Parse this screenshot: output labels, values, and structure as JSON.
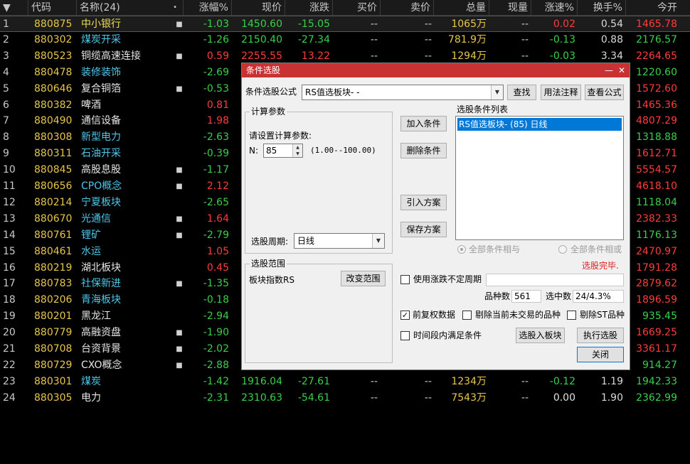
{
  "table": {
    "headers": [
      "代码",
      "名称(24)",
      "涨幅%",
      "现价",
      "涨跌",
      "买价",
      "卖价",
      "总量",
      "现量",
      "涨速%",
      "换手%",
      "今开"
    ],
    "sort_indicator": "•",
    "rows": [
      {
        "idx": "1",
        "code": "880875",
        "name": "中小银行",
        "name_color": "yellow",
        "mark": "■",
        "pct": "-1.03",
        "price": "1450.60",
        "chg": "-15.05",
        "bid": "--",
        "ask": "--",
        "vol": "1065万",
        "cur": "--",
        "spd": "0.02",
        "turn": "0.54",
        "open": "1465.78",
        "dir": "down",
        "spd_dir": "up",
        "open_dir": "up"
      },
      {
        "idx": "2",
        "code": "880302",
        "name": "煤炭开采",
        "name_color": "cyan",
        "mark": "",
        "pct": "-1.26",
        "price": "2150.40",
        "chg": "-27.34",
        "bid": "--",
        "ask": "--",
        "vol": "781.9万",
        "cur": "--",
        "spd": "-0.13",
        "turn": "0.88",
        "open": "2176.57",
        "dir": "down",
        "spd_dir": "down",
        "open_dir": "down"
      },
      {
        "idx": "3",
        "code": "880523",
        "name": "铜缆高速连接",
        "name_color": "white",
        "mark": "■",
        "pct": "0.59",
        "price": "2255.55",
        "chg": "13.22",
        "bid": "--",
        "ask": "--",
        "vol": "1294万",
        "cur": "--",
        "spd": "-0.03",
        "turn": "3.34",
        "open": "2264.65",
        "dir": "up",
        "spd_dir": "down",
        "open_dir": "up"
      },
      {
        "idx": "4",
        "code": "880478",
        "name": "装修装饰",
        "name_color": "cyan",
        "mark": "",
        "pct": "-2.69",
        "open": "1220.60",
        "dir": "down",
        "open_dir": "down"
      },
      {
        "idx": "5",
        "code": "880646",
        "name": "复合铜箔",
        "name_color": "white",
        "mark": "■",
        "pct": "-0.53",
        "open": "1572.60",
        "dir": "down",
        "open_dir": "up"
      },
      {
        "idx": "6",
        "code": "880382",
        "name": "啤酒",
        "name_color": "white",
        "mark": "",
        "pct": "0.81",
        "open": "1465.36",
        "dir": "up",
        "open_dir": "up"
      },
      {
        "idx": "7",
        "code": "880490",
        "name": "通信设备",
        "name_color": "white",
        "mark": "",
        "pct": "1.98",
        "open": "4807.29",
        "dir": "up",
        "open_dir": "up"
      },
      {
        "idx": "8",
        "code": "880308",
        "name": "新型电力",
        "name_color": "cyan",
        "mark": "",
        "pct": "-2.63",
        "open": "1318.88",
        "dir": "down",
        "open_dir": "down"
      },
      {
        "idx": "9",
        "code": "880311",
        "name": "石油开采",
        "name_color": "cyan",
        "mark": "",
        "pct": "-0.39",
        "open": "1612.71",
        "dir": "down",
        "open_dir": "up"
      },
      {
        "idx": "10",
        "code": "880845",
        "name": "高股息股",
        "name_color": "white",
        "mark": "■",
        "pct": "-1.17",
        "open": "5554.57",
        "dir": "down",
        "open_dir": "up"
      },
      {
        "idx": "11",
        "code": "880656",
        "name": "CPO概念",
        "name_color": "cyan",
        "mark": "■",
        "pct": "2.12",
        "open": "4618.10",
        "dir": "up",
        "open_dir": "up"
      },
      {
        "idx": "12",
        "code": "880214",
        "name": "宁夏板块",
        "name_color": "cyan",
        "mark": "",
        "pct": "-2.65",
        "open": "1118.04",
        "dir": "down",
        "open_dir": "down"
      },
      {
        "idx": "13",
        "code": "880670",
        "name": "光通信",
        "name_color": "cyan",
        "mark": "■",
        "pct": "1.64",
        "open": "2382.33",
        "dir": "up",
        "open_dir": "up"
      },
      {
        "idx": "14",
        "code": "880761",
        "name": "锂矿",
        "name_color": "cyan",
        "mark": "■",
        "pct": "-2.79",
        "open": "1176.13",
        "dir": "down",
        "open_dir": "down"
      },
      {
        "idx": "15",
        "code": "880461",
        "name": "水运",
        "name_color": "cyan",
        "mark": "",
        "pct": "1.05",
        "open": "2470.97",
        "dir": "up",
        "open_dir": "up"
      },
      {
        "idx": "16",
        "code": "880219",
        "name": "湖北板块",
        "name_color": "white",
        "mark": "",
        "pct": "0.45",
        "open": "1791.28",
        "dir": "up",
        "open_dir": "up"
      },
      {
        "idx": "17",
        "code": "880783",
        "name": "社保新进",
        "name_color": "cyan",
        "mark": "■",
        "pct": "-1.35",
        "open": "2879.62",
        "dir": "down",
        "open_dir": "up"
      },
      {
        "idx": "18",
        "code": "880206",
        "name": "青海板块",
        "name_color": "cyan",
        "mark": "",
        "pct": "-0.18",
        "open": "1896.59",
        "dir": "down",
        "open_dir": "up"
      },
      {
        "idx": "19",
        "code": "880201",
        "name": "黑龙江",
        "name_color": "white",
        "mark": "",
        "pct": "-2.94",
        "open": "935.45",
        "dir": "down",
        "open_dir": "down"
      },
      {
        "idx": "20",
        "code": "880779",
        "name": "高融资盘",
        "name_color": "white",
        "mark": "■",
        "pct": "-1.90",
        "open": "1669.25",
        "dir": "down",
        "open_dir": "up"
      },
      {
        "idx": "21",
        "code": "880708",
        "name": "台资背景",
        "name_color": "white",
        "mark": "■",
        "pct": "-2.02",
        "open": "3361.17",
        "dir": "down",
        "open_dir": "up"
      },
      {
        "idx": "22",
        "code": "880729",
        "name": "CXO概念",
        "name_color": "white",
        "mark": "■",
        "pct": "-2.88",
        "open": "914.27",
        "dir": "down",
        "open_dir": "down"
      },
      {
        "idx": "23",
        "code": "880301",
        "name": "煤炭",
        "name_color": "cyan",
        "mark": "",
        "pct": "-1.42",
        "price": "1916.04",
        "chg": "-27.61",
        "bid": "--",
        "ask": "--",
        "vol": "1234万",
        "cur": "--",
        "spd": "-0.12",
        "turn": "1.19",
        "open": "1942.33",
        "dir": "down",
        "spd_dir": "down",
        "open_dir": "down"
      },
      {
        "idx": "24",
        "code": "880305",
        "name": "电力",
        "name_color": "white",
        "mark": "",
        "pct": "-2.31",
        "price": "2310.63",
        "chg": "-54.61",
        "bid": "--",
        "ask": "--",
        "vol": "7543万",
        "cur": "--",
        "spd": "0.00",
        "turn": "1.90",
        "open": "2362.99",
        "dir": "down",
        "spd_dir": "flat",
        "open_dir": "down"
      }
    ]
  },
  "dialog": {
    "title": "条件选股",
    "formula_label": "条件选股公式",
    "formula_value": "RS值选板块-  -",
    "buttons": {
      "find": "查找",
      "usage": "用法注释",
      "view_formula": "查看公式",
      "add_condition": "加入条件",
      "delete_condition": "删除条件",
      "import_plan": "引入方案",
      "save_plan": "保存方案",
      "change_range": "改变范围",
      "to_block": "选股入板块",
      "execute": "执行选股",
      "close": "关闭"
    },
    "params": {
      "group_title": "计算参数",
      "prompt": "请设置计算参数:",
      "n_label": "N:",
      "n_value": "85",
      "n_range": "(1.00--100.00)"
    },
    "period_label": "选股周期:",
    "period_value": "日线",
    "condition_list_title": "选股条件列表",
    "condition_items": [
      "RS值选板块- (85) 日线"
    ],
    "radio_all_and": "全部条件相与",
    "radio_all_or": "全部条件相或",
    "status": "选股完毕.",
    "range": {
      "group_title": "选股范围",
      "value": "板块指数RS"
    },
    "use_variable_period": "使用涨跌不定周期",
    "count_label": "品种数",
    "count_value": "561",
    "selected_label": "选中数",
    "selected_value": "24/4.3%",
    "chk_forward_adjust": "前复权数据",
    "chk_exclude_untraded": "剔除当前未交易的品种",
    "chk_exclude_st": "剔除ST品种",
    "chk_in_period": "时间段内满足条件",
    "colors": {
      "title_bar": "#c83232",
      "selection": "#0078d7",
      "status": "#e02020"
    }
  },
  "colors": {
    "up": "#ff3b3b",
    "down": "#37d04a",
    "code": "#e6c64a",
    "cyan_name": "#4ec8e8"
  }
}
